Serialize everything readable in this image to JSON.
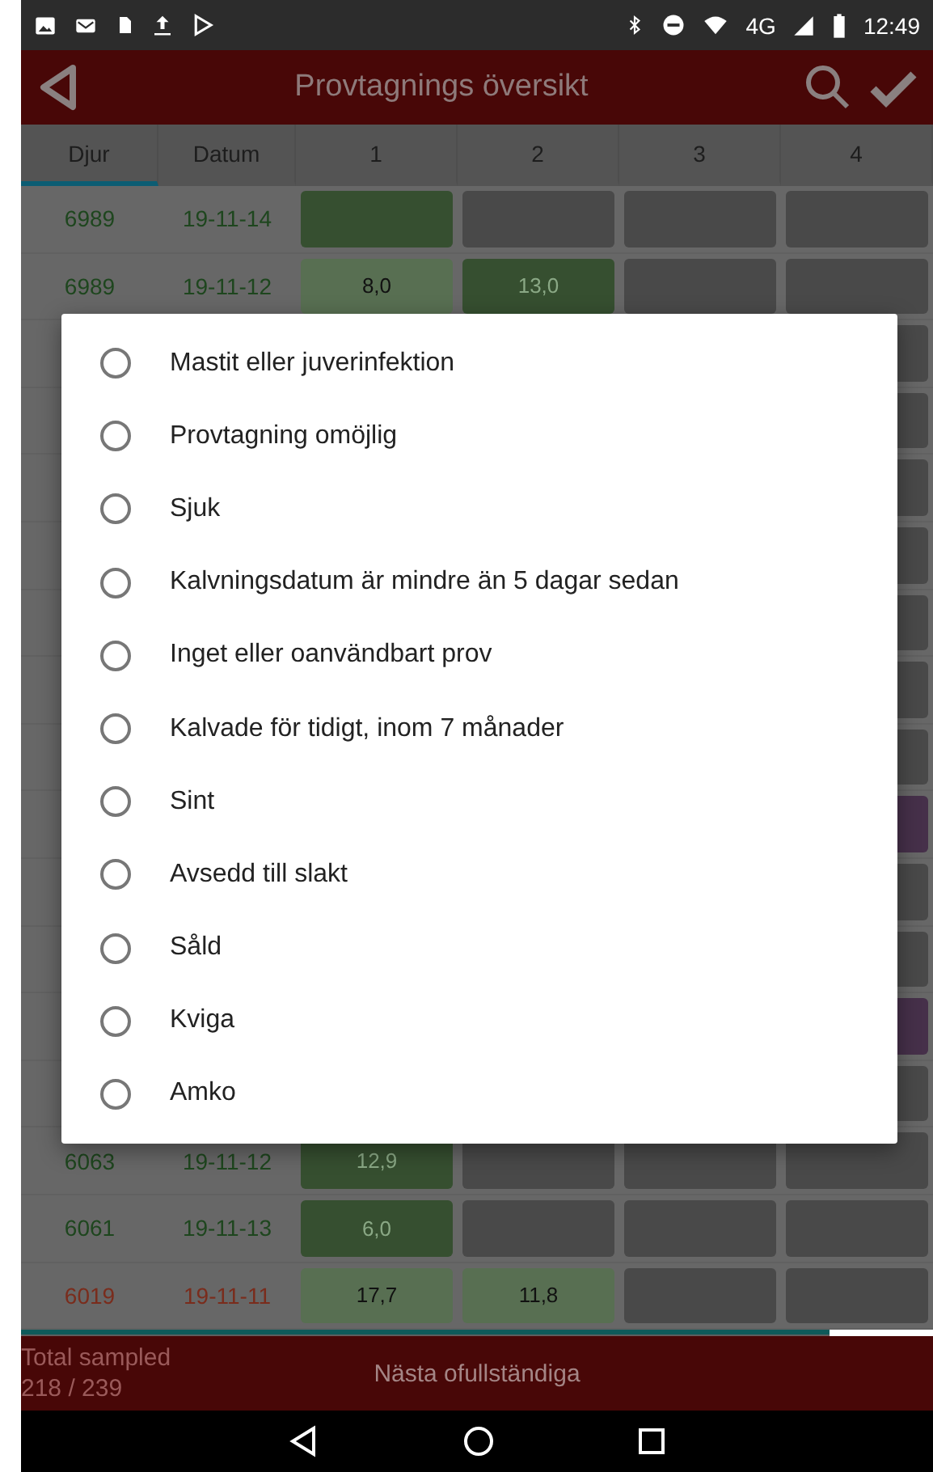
{
  "status_bar": {
    "network": "4G",
    "time": "12:49"
  },
  "app_bar": {
    "title": "Provtagnings översikt"
  },
  "table": {
    "columns": [
      {
        "label": "Djur",
        "selected": true
      },
      {
        "label": "Datum",
        "selected": false
      },
      {
        "label": "1",
        "selected": false
      },
      {
        "label": "2",
        "selected": false
      },
      {
        "label": "3",
        "selected": false
      },
      {
        "label": "4",
        "selected": false
      }
    ],
    "rows": [
      {
        "kind": "row",
        "overdue": false,
        "animal": "6989",
        "date": "19-11-14",
        "cells": [
          {
            "color": "#364f30"
          },
          {
            "color": "#494949"
          },
          {
            "color": "#494949"
          },
          {
            "color": "#494949"
          }
        ]
      },
      {
        "kind": "row",
        "overdue": false,
        "animal": "6989",
        "date": "19-11-12",
        "cells": [
          {
            "color": "#586f52",
            "value": "8,0"
          },
          {
            "color": "#364f30",
            "value": "13,0"
          },
          {
            "color": "#494949"
          },
          {
            "color": "#494949"
          }
        ]
      },
      {
        "kind": "covered",
        "color": "#494949"
      },
      {
        "kind": "covered",
        "color": "#494949"
      },
      {
        "kind": "covered",
        "color": "#494949"
      },
      {
        "kind": "covered",
        "color": "#494949"
      },
      {
        "kind": "covered",
        "color": "#494949"
      },
      {
        "kind": "covered",
        "color": "#494949"
      },
      {
        "kind": "covered",
        "color": "#494949"
      },
      {
        "kind": "covered",
        "color": "#46304a"
      },
      {
        "kind": "covered",
        "color": "#494949"
      },
      {
        "kind": "covered",
        "color": "#494949"
      },
      {
        "kind": "covered",
        "color": "#46304a"
      },
      {
        "kind": "covered",
        "color": "#494949"
      },
      {
        "kind": "row",
        "overdue": false,
        "animal": "6063",
        "date": "19-11-12",
        "cells": [
          {
            "color": "#364f30",
            "value": "12,9"
          },
          {
            "color": "#494949"
          },
          {
            "color": "#494949"
          },
          {
            "color": "#494949"
          }
        ]
      },
      {
        "kind": "row",
        "overdue": false,
        "animal": "6061",
        "date": "19-11-13",
        "cells": [
          {
            "color": "#364f30",
            "value": "6,0"
          },
          {
            "color": "#494949"
          },
          {
            "color": "#494949"
          },
          {
            "color": "#494949"
          }
        ]
      },
      {
        "kind": "row",
        "overdue": true,
        "animal": "6019",
        "date": "19-11-11",
        "cells": [
          {
            "color": "#586f52",
            "value": "17,7"
          },
          {
            "color": "#586f52",
            "value": "11,8"
          },
          {
            "color": "#494949"
          },
          {
            "color": "#494949"
          }
        ]
      }
    ]
  },
  "dialog": {
    "options": [
      {
        "label": "Mastit eller juverinfektion",
        "selected": false
      },
      {
        "label": "Provtagning omöjlig",
        "selected": false
      },
      {
        "label": "Sjuk",
        "selected": false
      },
      {
        "label": "Kalvningsdatum är mindre än 5 dagar sedan",
        "selected": false
      },
      {
        "label": "Inget eller oanvändbart prov",
        "selected": false
      },
      {
        "label": "Kalvade för tidigt, inom 7 månader",
        "selected": false
      },
      {
        "label": "Sint",
        "selected": false
      },
      {
        "label": "Avsedd till slakt",
        "selected": false
      },
      {
        "label": "Såld",
        "selected": false
      },
      {
        "label": "Kviga",
        "selected": false
      },
      {
        "label": "Amko",
        "selected": false
      }
    ]
  },
  "footer": {
    "total_label": "Total sampled",
    "total_value": "218 / 239",
    "next_button": "Nästa ofullständiga"
  }
}
